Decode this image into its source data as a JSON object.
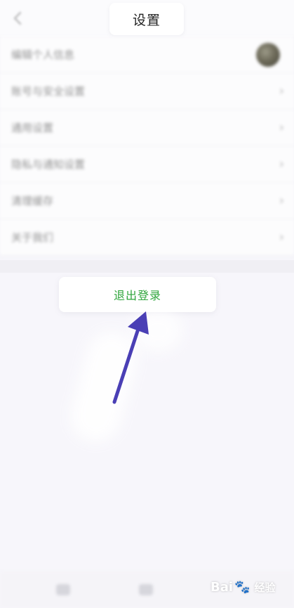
{
  "header": {
    "title": "设置"
  },
  "settings": {
    "rows": [
      {
        "label": "编辑个人信息",
        "trailing": "avatar"
      },
      {
        "label": "账号与安全设置",
        "trailing": "chevron"
      },
      {
        "label": "通用设置",
        "trailing": "chevron"
      },
      {
        "label": "隐私与通知设置",
        "trailing": "chevron"
      },
      {
        "label": "清理缓存",
        "trailing": "chevron"
      },
      {
        "label": "关于我们",
        "trailing": "chevron"
      }
    ]
  },
  "logout": {
    "label": "退出登录"
  },
  "colors": {
    "logout_text": "#2da43a",
    "arrow": "#4a3fb5"
  },
  "watermark": {
    "brand_left": "Bai",
    "brand_right": "经验"
  }
}
